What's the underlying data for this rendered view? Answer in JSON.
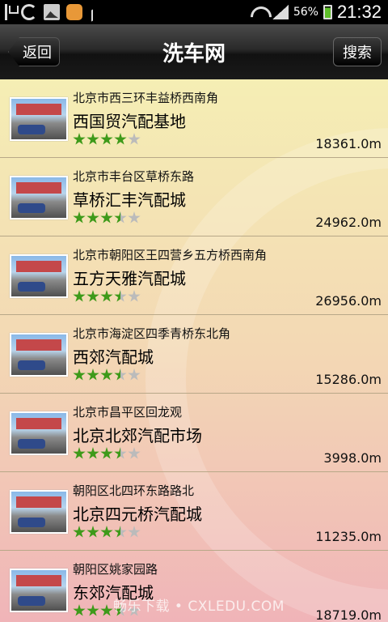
{
  "status_bar": {
    "battery": "56%",
    "time": "21:32",
    "icons": [
      "usb-icon",
      "recycle-icon",
      "image-icon",
      "message-icon",
      "share-icon",
      "wifi-icon",
      "signal-icon",
      "battery-icon"
    ]
  },
  "header": {
    "title": "洗车网",
    "back_label": "返回",
    "search_label": "搜索"
  },
  "items": [
    {
      "address": "北京市西三环丰益桥西南角",
      "name": "西国贸汽配基地",
      "rating": 4,
      "distance": "18361.0m"
    },
    {
      "address": "北京市丰台区草桥东路",
      "name": "草桥汇丰汽配城",
      "rating": 3.5,
      "distance": "24962.0m"
    },
    {
      "address": "北京市朝阳区王四营乡五方桥西南角",
      "name": "五方天雅汽配城",
      "rating": 3.5,
      "distance": "26956.0m"
    },
    {
      "address": "北京市海淀区四季青桥东北角",
      "name": "西郊汽配城",
      "rating": 3.5,
      "distance": "15286.0m"
    },
    {
      "address": "北京市昌平区回龙观",
      "name": "北京北郊汽配市场",
      "rating": 3.5,
      "distance": "3998.0m"
    },
    {
      "address": "朝阳区北四环东路路北",
      "name": "北京四元桥汽配城",
      "rating": 3.5,
      "distance": "11235.0m"
    },
    {
      "address": "朝阳区姚家园路",
      "name": "东郊汽配城",
      "rating": 3.5,
      "distance": "18719.0m"
    }
  ],
  "watermark": "畅乐下载 • CXLEDU.COM",
  "colors": {
    "star_filled": "#3e9a1a",
    "star_empty": "#bbbbbb",
    "list_top": "#f5eeb4",
    "list_bottom": "#f0b4b8"
  }
}
